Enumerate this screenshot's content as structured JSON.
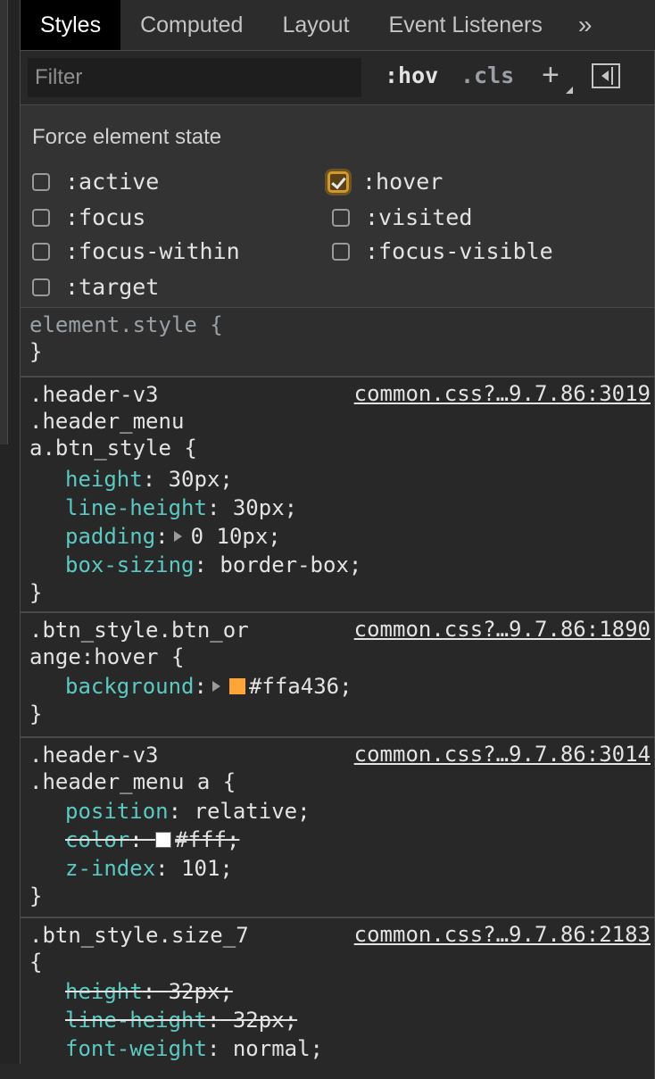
{
  "tabs": [
    {
      "label": "Styles",
      "active": true
    },
    {
      "label": "Computed",
      "active": false
    },
    {
      "label": "Layout",
      "active": false
    },
    {
      "label": "Event Listeners",
      "active": false
    }
  ],
  "tabs_more": "»",
  "filter": {
    "placeholder": "Filter",
    "hov": ":hov",
    "cls": ".cls",
    "plus": "+"
  },
  "force_state": {
    "title": "Force element state",
    "states": [
      {
        "label": ":active",
        "checked": false
      },
      {
        "label": ":hover",
        "checked": true
      },
      {
        "label": ":focus",
        "checked": false
      },
      {
        "label": ":visited",
        "checked": false
      },
      {
        "label": ":focus-within",
        "checked": false
      },
      {
        "label": ":focus-visible",
        "checked": false
      },
      {
        "label": ":target",
        "checked": false
      }
    ]
  },
  "rules": [
    {
      "selector": [
        "element.style {"
      ],
      "source": "",
      "declarations": [],
      "close": "}"
    },
    {
      "selector": [
        ".header-v3",
        ".header_menu",
        "a.btn_style {"
      ],
      "source": "common.css?…9.7.86:3019",
      "declarations": [
        {
          "prop": "height",
          "value": "30px;"
        },
        {
          "prop": "line-height",
          "value": "30px;"
        },
        {
          "prop": "padding",
          "value": "0 10px;"
        },
        {
          "prop": "box-sizing",
          "value": "border-box;"
        }
      ],
      "close": "}"
    },
    {
      "selector": [
        ".btn_style.btn_or",
        "ange:hover {"
      ],
      "source": "common.css?…9.7.86:1890",
      "declarations": [
        {
          "prop": "background",
          "value": "#ffa436;",
          "swatch": "#ffa436"
        }
      ],
      "close": "}"
    },
    {
      "selector": [
        ".header-v3",
        ".header_menu a {"
      ],
      "source": "common.css?…9.7.86:3014",
      "declarations": [
        {
          "prop": "position",
          "value": "relative;"
        },
        {
          "prop": "color",
          "value": "#fff;",
          "swatch": "#ffffff",
          "struck": true
        },
        {
          "prop": "z-index",
          "value": "101;"
        }
      ],
      "close": "}"
    },
    {
      "selector": [
        ".btn_style.size_7",
        "{"
      ],
      "source": "common.css?…9.7.86:2183",
      "declarations": [
        {
          "prop": "height",
          "value": "32px;",
          "struck": true
        },
        {
          "prop": "line-height",
          "value": "32px;",
          "struck": true
        },
        {
          "prop": "font-weight",
          "value": "normal;"
        }
      ],
      "close": ""
    }
  ],
  "colors": {
    "accent_checkbox": "#d09a30",
    "property": "#5db0d7",
    "swatch_orange": "#ffa436"
  }
}
